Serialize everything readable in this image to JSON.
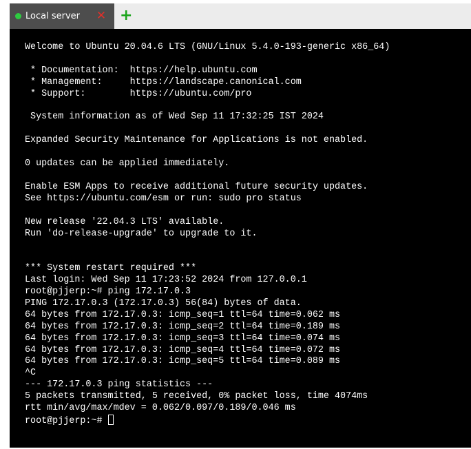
{
  "tab": {
    "label": "Local server",
    "status_icon": "status-dot-icon",
    "status_color": "#2ecc40",
    "close_symbol": "✕",
    "close_color": "#e0302a"
  },
  "add_tab": {
    "symbol": "+",
    "color": "#1aa51a"
  },
  "terminal": {
    "lines": [
      "Welcome to Ubuntu 20.04.6 LTS (GNU/Linux 5.4.0-193-generic x86_64)",
      "",
      " * Documentation:  https://help.ubuntu.com",
      " * Management:     https://landscape.canonical.com",
      " * Support:        https://ubuntu.com/pro",
      "",
      " System information as of Wed Sep 11 17:32:25 IST 2024",
      "",
      "Expanded Security Maintenance for Applications is not enabled.",
      "",
      "0 updates can be applied immediately.",
      "",
      "Enable ESM Apps to receive additional future security updates.",
      "See https://ubuntu.com/esm or run: sudo pro status",
      "",
      "New release '22.04.3 LTS' available.",
      "Run 'do-release-upgrade' to upgrade to it.",
      "",
      "",
      "*** System restart required ***",
      "Last login: Wed Sep 11 17:23:52 2024 from 127.0.0.1",
      "root@pjjerp:~# ping 172.17.0.3",
      "PING 172.17.0.3 (172.17.0.3) 56(84) bytes of data.",
      "64 bytes from 172.17.0.3: icmp_seq=1 ttl=64 time=0.062 ms",
      "64 bytes from 172.17.0.3: icmp_seq=2 ttl=64 time=0.189 ms",
      "64 bytes from 172.17.0.3: icmp_seq=3 ttl=64 time=0.074 ms",
      "64 bytes from 172.17.0.3: icmp_seq=4 ttl=64 time=0.072 ms",
      "64 bytes from 172.17.0.3: icmp_seq=5 ttl=64 time=0.089 ms",
      "^C",
      "--- 172.17.0.3 ping statistics ---",
      "5 packets transmitted, 5 received, 0% packet loss, time 4074ms",
      "rtt min/avg/max/mdev = 0.062/0.097/0.189/0.046 ms"
    ],
    "prompt": "root@pjjerp:~# "
  }
}
